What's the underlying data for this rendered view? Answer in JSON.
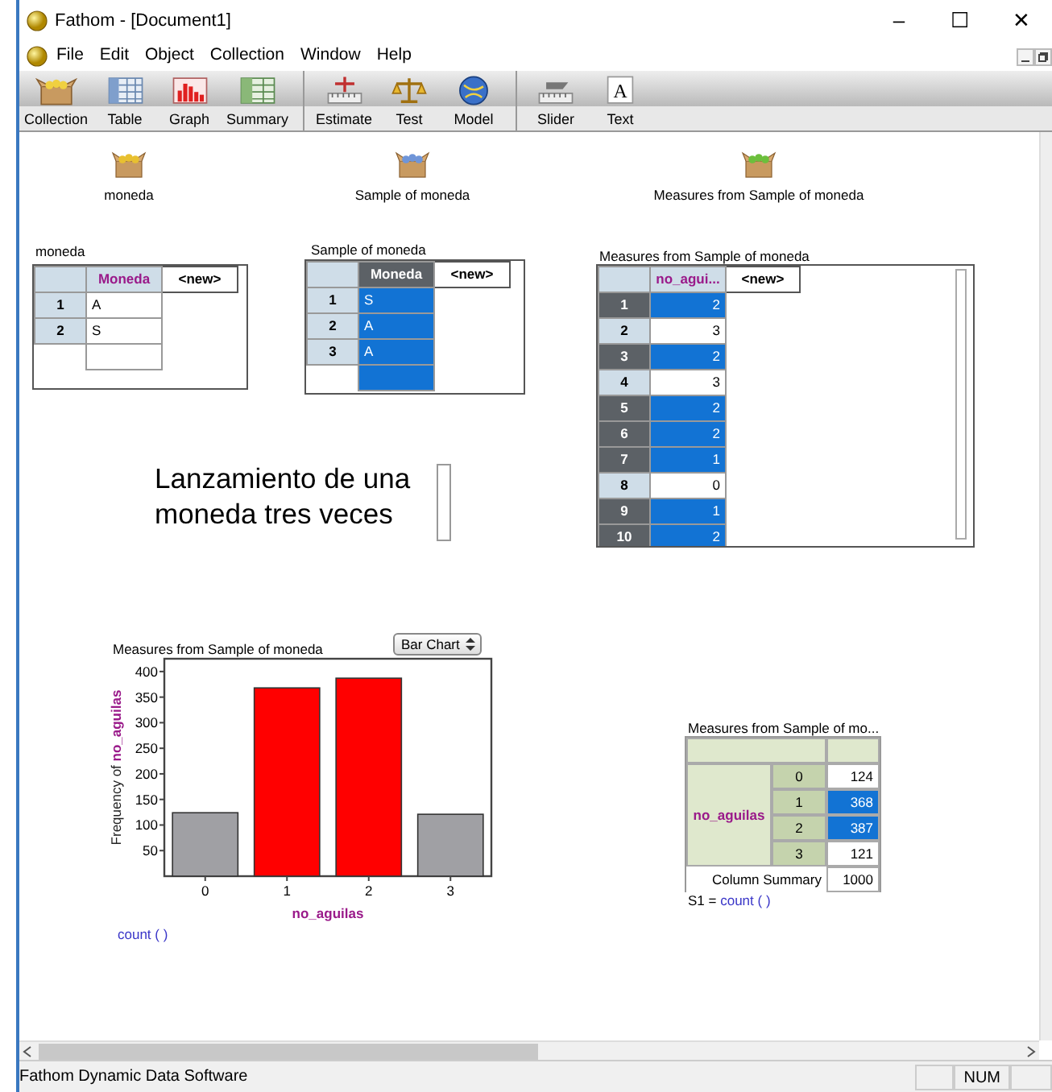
{
  "window": {
    "title": "Fathom - [Document1]",
    "controls": [
      "–",
      "☐",
      "✕"
    ]
  },
  "menu": [
    "File",
    "Edit",
    "Object",
    "Collection",
    "Window",
    "Help"
  ],
  "toolbar_groups": [
    {
      "tools": [
        {
          "label": "Collection",
          "kind": "collection"
        },
        {
          "label": "Table",
          "kind": "table"
        },
        {
          "label": "Graph",
          "kind": "graph"
        },
        {
          "label": "Summary",
          "kind": "summary"
        }
      ]
    },
    {
      "tools": [
        {
          "label": "Estimate",
          "kind": "estimate"
        },
        {
          "label": "Test",
          "kind": "test"
        },
        {
          "label": "Model",
          "kind": "model"
        }
      ]
    },
    {
      "tools": [
        {
          "label": "Slider",
          "kind": "slider"
        },
        {
          "label": "Text",
          "kind": "text",
          "glyph": "A"
        }
      ]
    }
  ],
  "collections": [
    {
      "label": "moneda",
      "color": "#e8c030"
    },
    {
      "label": "Sample of moneda",
      "color": "#6f95d8"
    },
    {
      "label": "Measures from Sample of moneda",
      "color": "#6cbf3c"
    }
  ],
  "tables": [
    {
      "title": "moneda",
      "new_column": "<new>",
      "blank_row": true,
      "columns": [
        {
          "name": "Moneda",
          "kind": "categorical",
          "selected": false
        }
      ],
      "rows": [
        {
          "index": "1",
          "values": [
            "A"
          ],
          "selected": false
        },
        {
          "index": "2",
          "values": [
            "S"
          ],
          "selected": false
        }
      ]
    },
    {
      "title": "Sample of moneda",
      "new_column": "<new>",
      "blank_row": true,
      "columns": [
        {
          "name": "Moneda",
          "kind": "categorical",
          "selected": true
        }
      ],
      "rows": [
        {
          "index": "1",
          "values": [
            "S"
          ],
          "selected": false
        },
        {
          "index": "2",
          "values": [
            "A"
          ],
          "selected": false
        },
        {
          "index": "3",
          "values": [
            "A"
          ],
          "selected": false
        }
      ]
    },
    {
      "title": "Measures from Sample of moneda",
      "new_column": "<new>",
      "columns": [
        {
          "name": "no_agui...",
          "kind": "numeric",
          "selected": false
        }
      ],
      "rows": [
        {
          "index": "1",
          "values": [
            "2"
          ],
          "selected": true
        },
        {
          "index": "2",
          "values": [
            "3"
          ],
          "selected": false
        },
        {
          "index": "3",
          "values": [
            "2"
          ],
          "selected": true
        },
        {
          "index": "4",
          "values": [
            "3"
          ],
          "selected": false
        },
        {
          "index": "5",
          "values": [
            "2"
          ],
          "selected": true
        },
        {
          "index": "6",
          "values": [
            "2"
          ],
          "selected": true
        },
        {
          "index": "7",
          "values": [
            "1"
          ],
          "selected": true
        },
        {
          "index": "8",
          "values": [
            "0"
          ],
          "selected": false
        },
        {
          "index": "9",
          "values": [
            "1"
          ],
          "selected": true
        },
        {
          "index": "10",
          "values": [
            "2"
          ],
          "selected": true
        }
      ]
    }
  ],
  "text_box": {
    "text": "Lanzamiento de una\nmoneda tres veces"
  },
  "graph": {
    "type_menu": "Bar Chart",
    "formula": "count ( )",
    "chart_data": {
      "type": "bar",
      "title": "Measures from Sample of moneda",
      "xlabel": "no_aguilas",
      "ylabel": "Frequency of no_aguilas",
      "categories": [
        "0",
        "1",
        "2",
        "3"
      ],
      "series": [
        {
          "color": "#a0a0a4",
          "values": [
            124,
            null,
            null,
            121
          ]
        },
        {
          "color": "#ff0000",
          "values": [
            null,
            368,
            387,
            null
          ]
        }
      ],
      "stacked": true,
      "ylim": [
        0,
        425
      ],
      "yticks": [
        50,
        100,
        150,
        200,
        250,
        300,
        350,
        400
      ]
    }
  },
  "summary": {
    "title": "Measures from Sample of mo...",
    "row_attribute": "no_aguilas",
    "rows": [
      {
        "label": "0",
        "value": "124",
        "selected": false
      },
      {
        "label": "1",
        "value": "368",
        "selected": true
      },
      {
        "label": "2",
        "value": "387",
        "selected": true
      },
      {
        "label": "3",
        "value": "121",
        "selected": false
      }
    ],
    "footer_label": "Column Summary",
    "footer_value": "1000",
    "formula_name": "S1 =",
    "formula": "count ( )"
  },
  "status_bar": {
    "text": "Fathom Dynamic Data Software",
    "indicators": [
      "NUM"
    ]
  }
}
